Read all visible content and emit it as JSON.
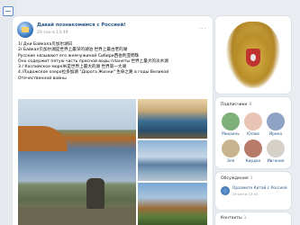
{
  "post": {
    "group_name": "Давай познакомимся с Россией!",
    "date": "29 сен в 13:49",
    "more_icon": "ellipsis-icon",
    "lines": [
      "1/ Дни Байкала贝加尔湖日",
      "2/ Байкал贝加尔湖是世界上最深的湖泊 世界上最古老的湖",
      "Русские называют его жемчужиной Сибири西伯利亚明珠",
      "Оно содержит пятую часть пресной воды планеты 世界上最大的淡水湖",
      "3 / Каспийское мореЖ是世界上最大的湖 世界第一大湖",
      "4 /Ладожское озеро拉多加湖 \"Дорога Жизни\" 生命之路 в годы Великой",
      "Отечественной войны"
    ]
  },
  "subscribers": {
    "title": "Подписчики",
    "count": "6",
    "items": [
      {
        "name": "Михаиль",
        "color": "#7fb07a"
      },
      {
        "name": "Юлию",
        "color": "#e9c4b4"
      },
      {
        "name": "Ирина",
        "color": "#8fa4c4"
      },
      {
        "name": "Эля",
        "color": "#c8b48e"
      },
      {
        "name": "Кирдан",
        "color": "#b77b6a"
      },
      {
        "name": "Ивгения",
        "color": "#d5d1c8"
      }
    ]
  },
  "links": {
    "title": "Обсуждения",
    "count": "1",
    "item_title": "Оразмите Китай с Россией",
    "item_sub": "29 сен в 13:41"
  },
  "contacts": {
    "title": "Контакты",
    "count": "1"
  },
  "accent": "#2a5885"
}
